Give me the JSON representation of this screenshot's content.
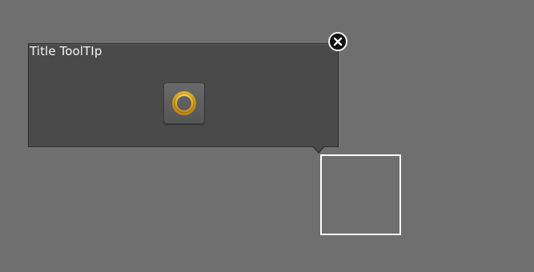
{
  "tooltip": {
    "title": "Title ToolTIp",
    "loader_icon": "loading-ring-icon",
    "close_icon": "close-icon"
  },
  "colors": {
    "background": "#6f6f6f",
    "tooltip_bg": "#4a4a4a",
    "ring_outer": "#f3c64c",
    "ring_inner": "#b88717",
    "close_bg": "#111111"
  }
}
